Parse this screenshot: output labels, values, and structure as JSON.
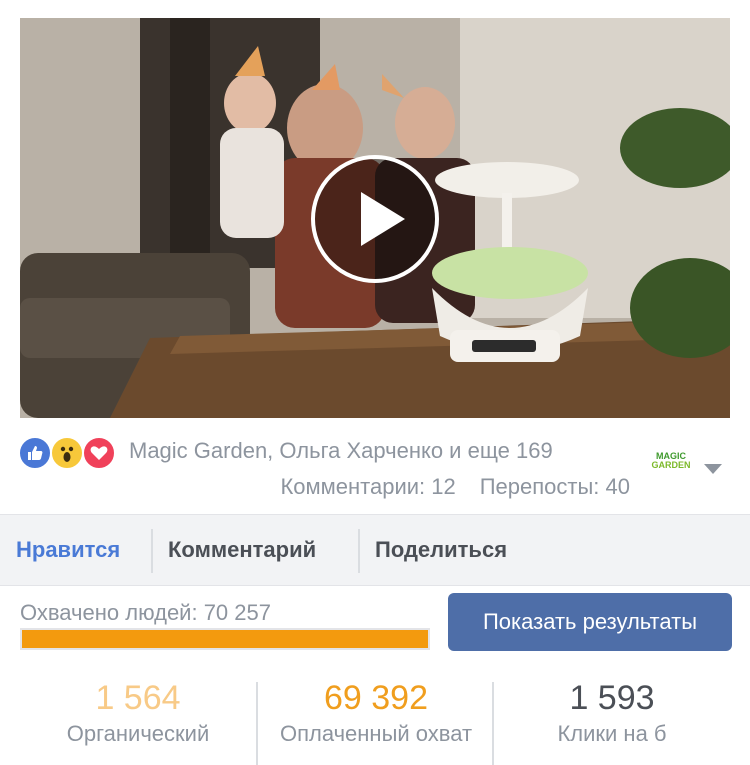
{
  "video": {
    "play_icon": "play-icon"
  },
  "reactions": {
    "icons": [
      "like-icon",
      "wow-icon",
      "love-icon"
    ],
    "names_text": "Magic Garden, Ольга Харченко и еще 169",
    "comments": "Комментарии: 12",
    "shares": "Перепосты: 40"
  },
  "page_logo": {
    "line1": "MAGIC",
    "line2": "GARDEN"
  },
  "actions": {
    "like": "Нравится",
    "comment": "Комментарий",
    "share": "Поделиться"
  },
  "reach": {
    "label": "Охвачено людей: 70 257",
    "progress_fraction": 1.0,
    "button": "Показать результаты"
  },
  "stats": {
    "organic": {
      "value": "1 564",
      "label": "Органический"
    },
    "paid": {
      "value": "69 392",
      "label": "Оплаченный охват"
    },
    "clicks": {
      "value": "1 593",
      "label": "Клики на б"
    }
  },
  "colors": {
    "accent_blue": "#4a7ad6",
    "button_blue": "#4e6ea8",
    "progress_orange": "#f39a0e",
    "organic_color": "#f8ca87",
    "paid_color": "#f09e1e"
  }
}
